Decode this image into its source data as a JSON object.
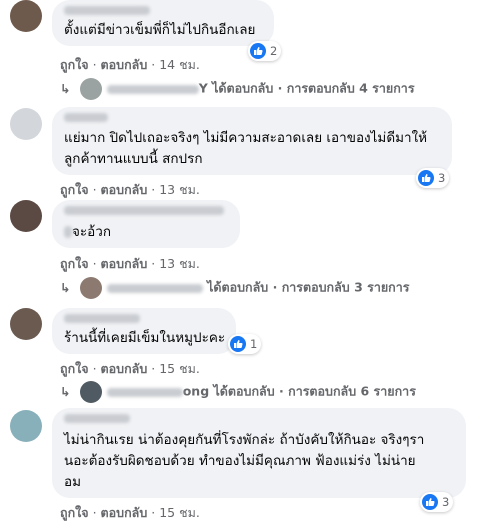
{
  "meta_labels": {
    "like": "ถูกใจ",
    "reply": "ตอบกลับ",
    "sep": "·"
  },
  "comments": [
    {
      "text_lines": [
        "ตั้งแต่มีข่าวเข็มพี่ก็ไม่ไปกินอีกเลย"
      ],
      "time": "14 ชม.",
      "reactions": "2",
      "replies": {
        "name_tail": "Y",
        "replied": "ได้ตอบกลับ",
        "summary": "การตอบกลับ 4 รายการ"
      }
    },
    {
      "text_lines": [
        "แย่มาก ปิดไปเถอะจริงๆ ไม่มีความสะอาดเลย เอาของไม่ดีมาให้",
        "ลูกค้าทานแบบนี้ สกปรก"
      ],
      "time": "13 ชม.",
      "reactions": "3"
    },
    {
      "text_lines": [
        "จะอ้วก"
      ],
      "time": "13 ชม.",
      "replies": {
        "name_tail": "",
        "replied": "ได้ตอบกลับ",
        "summary": "การตอบกลับ 3 รายการ"
      }
    },
    {
      "text_lines": [
        "ร้านนี้ที่เคยมีเข็มในหมูปะคะ"
      ],
      "time": "15 ชม.",
      "reactions": "1",
      "replies": {
        "name_tail": "ong",
        "replied": "ได้ตอบกลับ",
        "summary": "การตอบกลับ 6 รายการ"
      }
    },
    {
      "text_lines": [
        "ไม่น่ากินเรย น่าต้องคุยกันที่โรงพักล่ะ ถ้าบังคับให้กินอะ จริงๆรา",
        "นอะต้องรับผิดชอบด้วย ทำของไม่มีคุณภาพ ฟ้องแม่ร่ง ไม่น่าย",
        "อม"
      ],
      "time": "15 ชม.",
      "reactions": "3"
    }
  ],
  "colors": {
    "bubble": "#f0f2f5",
    "meta": "#65676b",
    "like_blue": "#1877f2"
  }
}
